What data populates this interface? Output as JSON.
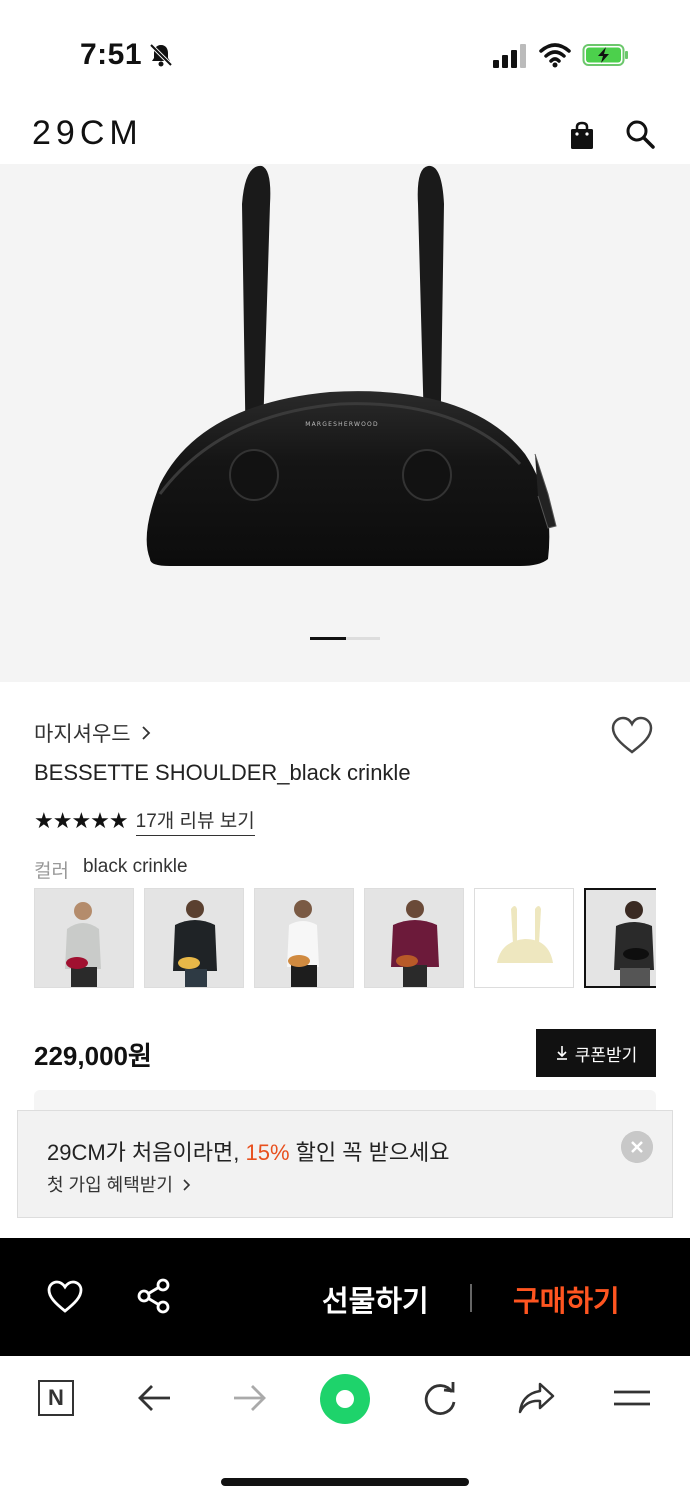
{
  "status_bar": {
    "time": "7:51"
  },
  "header": {
    "logo": "29CM"
  },
  "product": {
    "brand": "마지셔우드",
    "name": "BESSETTE SHOULDER_black crinkle",
    "bag_brand_mark": "MARGESHERWOOD",
    "rating_stars": 5,
    "stars_text": "★★★★★",
    "review_link": "17개 리뷰 보기",
    "color_label": "컬러",
    "color_value": "black crinkle",
    "price": "229,000원",
    "image_page": {
      "current": 1,
      "total": 2
    }
  },
  "coupon_button": {
    "label": "쿠폰받기"
  },
  "promo": {
    "title_prefix": "29CM가 처음이라면, ",
    "title_accent": "15%",
    "title_suffix": " 할인 꼭 받으세요",
    "subtitle": "첫 가입 혜택받기",
    "accent_color": "#e8501e"
  },
  "action_bar": {
    "gift_label": "선물하기",
    "buy_label": "구매하기",
    "buy_color": "#ff5520"
  },
  "browser": {
    "n_label": "N"
  },
  "icons": [
    "bell-off-icon",
    "signal-icon",
    "wifi-icon",
    "battery-charging-icon",
    "shopping-bag-icon",
    "search-icon",
    "heart-icon",
    "share-icon",
    "back-arrow-icon",
    "forward-arrow-icon",
    "green-home-icon",
    "reload-icon",
    "share-arrow-icon",
    "menu-icon"
  ]
}
